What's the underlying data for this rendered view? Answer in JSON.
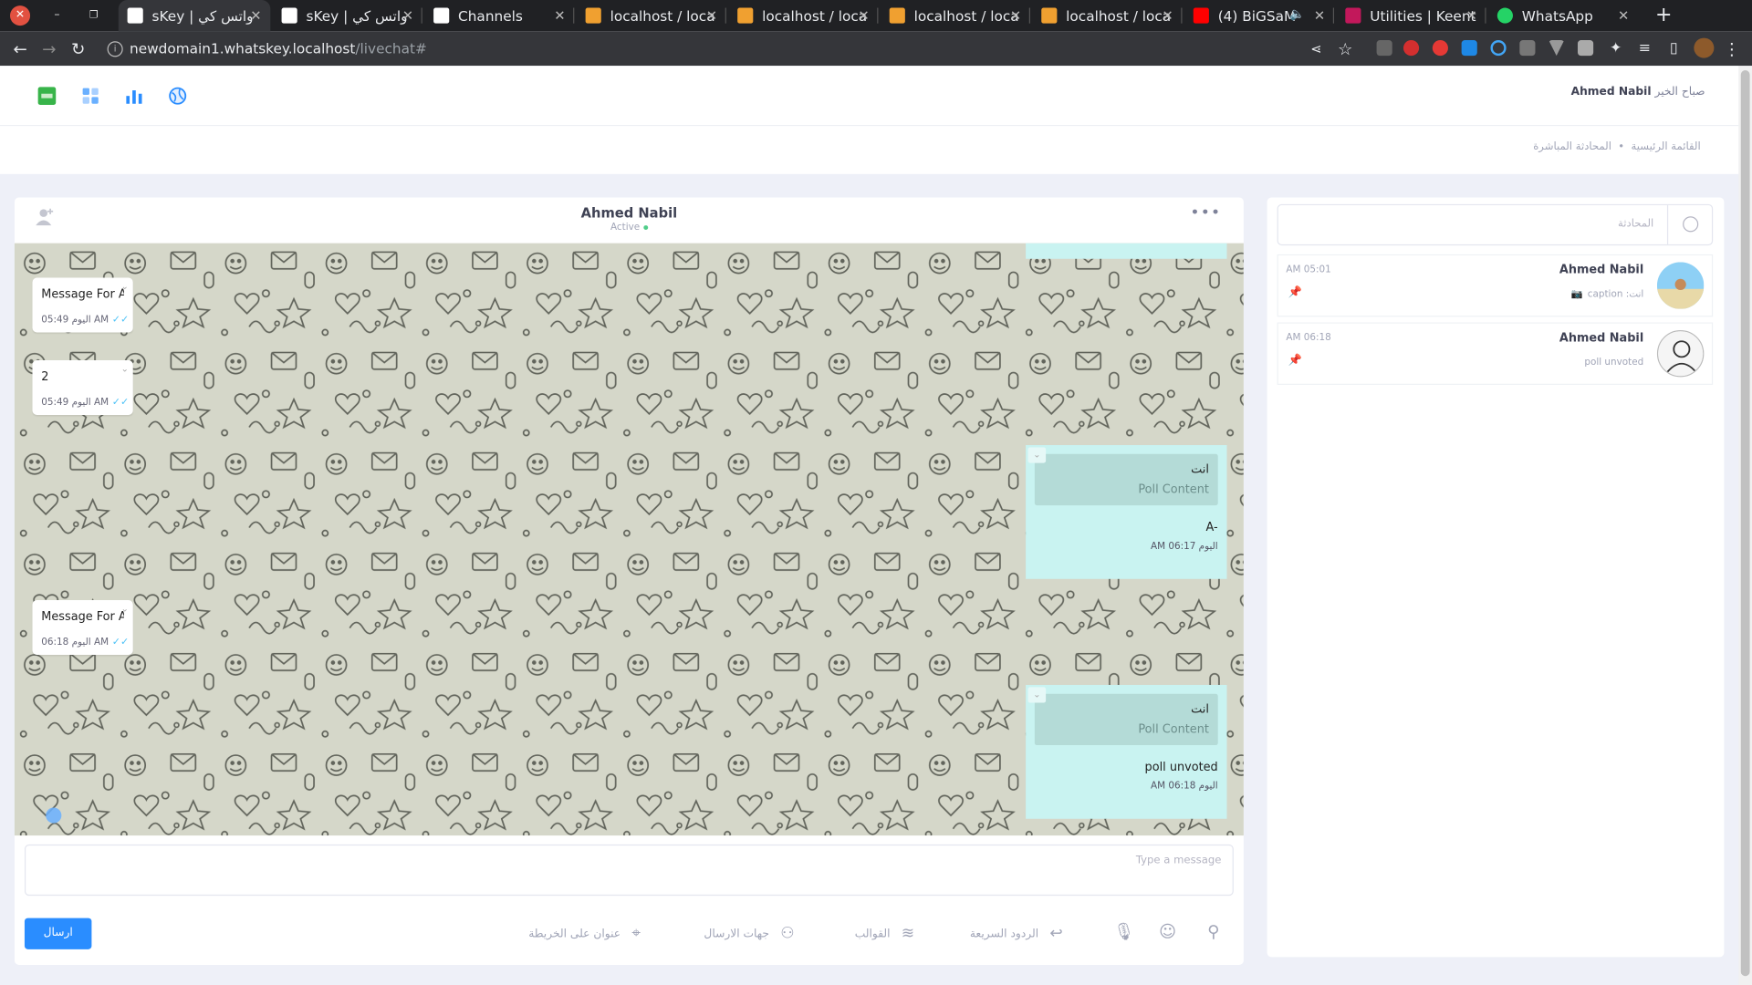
{
  "browser": {
    "tabs": [
      {
        "title": "sKey | واتس كي",
        "active": true,
        "fav": "#fff"
      },
      {
        "title": "sKey | واتس كي",
        "active": false,
        "fav": "#fff"
      },
      {
        "title": "Channels",
        "active": false,
        "fav": "#fff"
      },
      {
        "title": "localhost / loca",
        "active": false,
        "fav": "#f0a030"
      },
      {
        "title": "localhost / loca",
        "active": false,
        "fav": "#f0a030"
      },
      {
        "title": "localhost / loca",
        "active": false,
        "fav": "#f0a030"
      },
      {
        "title": "localhost / loca",
        "active": false,
        "fav": "#f0a030"
      },
      {
        "title": "(4) BiGSaM",
        "active": false,
        "fav": "#ff0000"
      },
      {
        "title": "Utilities | Keent",
        "active": false,
        "fav": "#c2185b"
      },
      {
        "title": "WhatsApp",
        "active": false,
        "fav": "#25d366"
      }
    ],
    "url_host": "newdomain1.whatskey.localhost",
    "url_path": "/livechat#"
  },
  "header": {
    "greeting": "صباح الخير",
    "user": "Ahmed Nabil"
  },
  "breadcrumb": {
    "home": "القائمة الرئيسية",
    "current": "المحادثة المباشرة"
  },
  "chat": {
    "contact_name": "Ahmed Nabil",
    "status": "Active",
    "incoming": [
      {
        "text": "Message For A",
        "time": "اليوم 05:49 AM"
      },
      {
        "text": "2",
        "time": "اليوم 05:49 AM"
      },
      {
        "text": "Message For A",
        "time": "اليوم 06:18 AM"
      }
    ],
    "outgoing": [
      {
        "who": "انت",
        "poll": "Poll Content",
        "body": "A-",
        "time": "اليوم 06:17 AM"
      },
      {
        "who": "انت",
        "poll": "Poll Content",
        "body": "poll unvoted",
        "time": "اليوم 06:18 AM"
      }
    ],
    "compose_placeholder": "Type a message",
    "send_label": "ارسال",
    "tools": {
      "map": "عنوان على الخريطة",
      "contacts": "جهات الارسال",
      "templates": "القوالب",
      "quick_replies": "الردود السريعة"
    }
  },
  "sidebar": {
    "search_placeholder": "المحادثة",
    "conversations": [
      {
        "name": "Ahmed Nabil",
        "preview": "انت: caption",
        "time": "AM 05:01"
      },
      {
        "name": "Ahmed Nabil",
        "preview": "poll unvoted",
        "time": "AM 06:18"
      }
    ]
  }
}
